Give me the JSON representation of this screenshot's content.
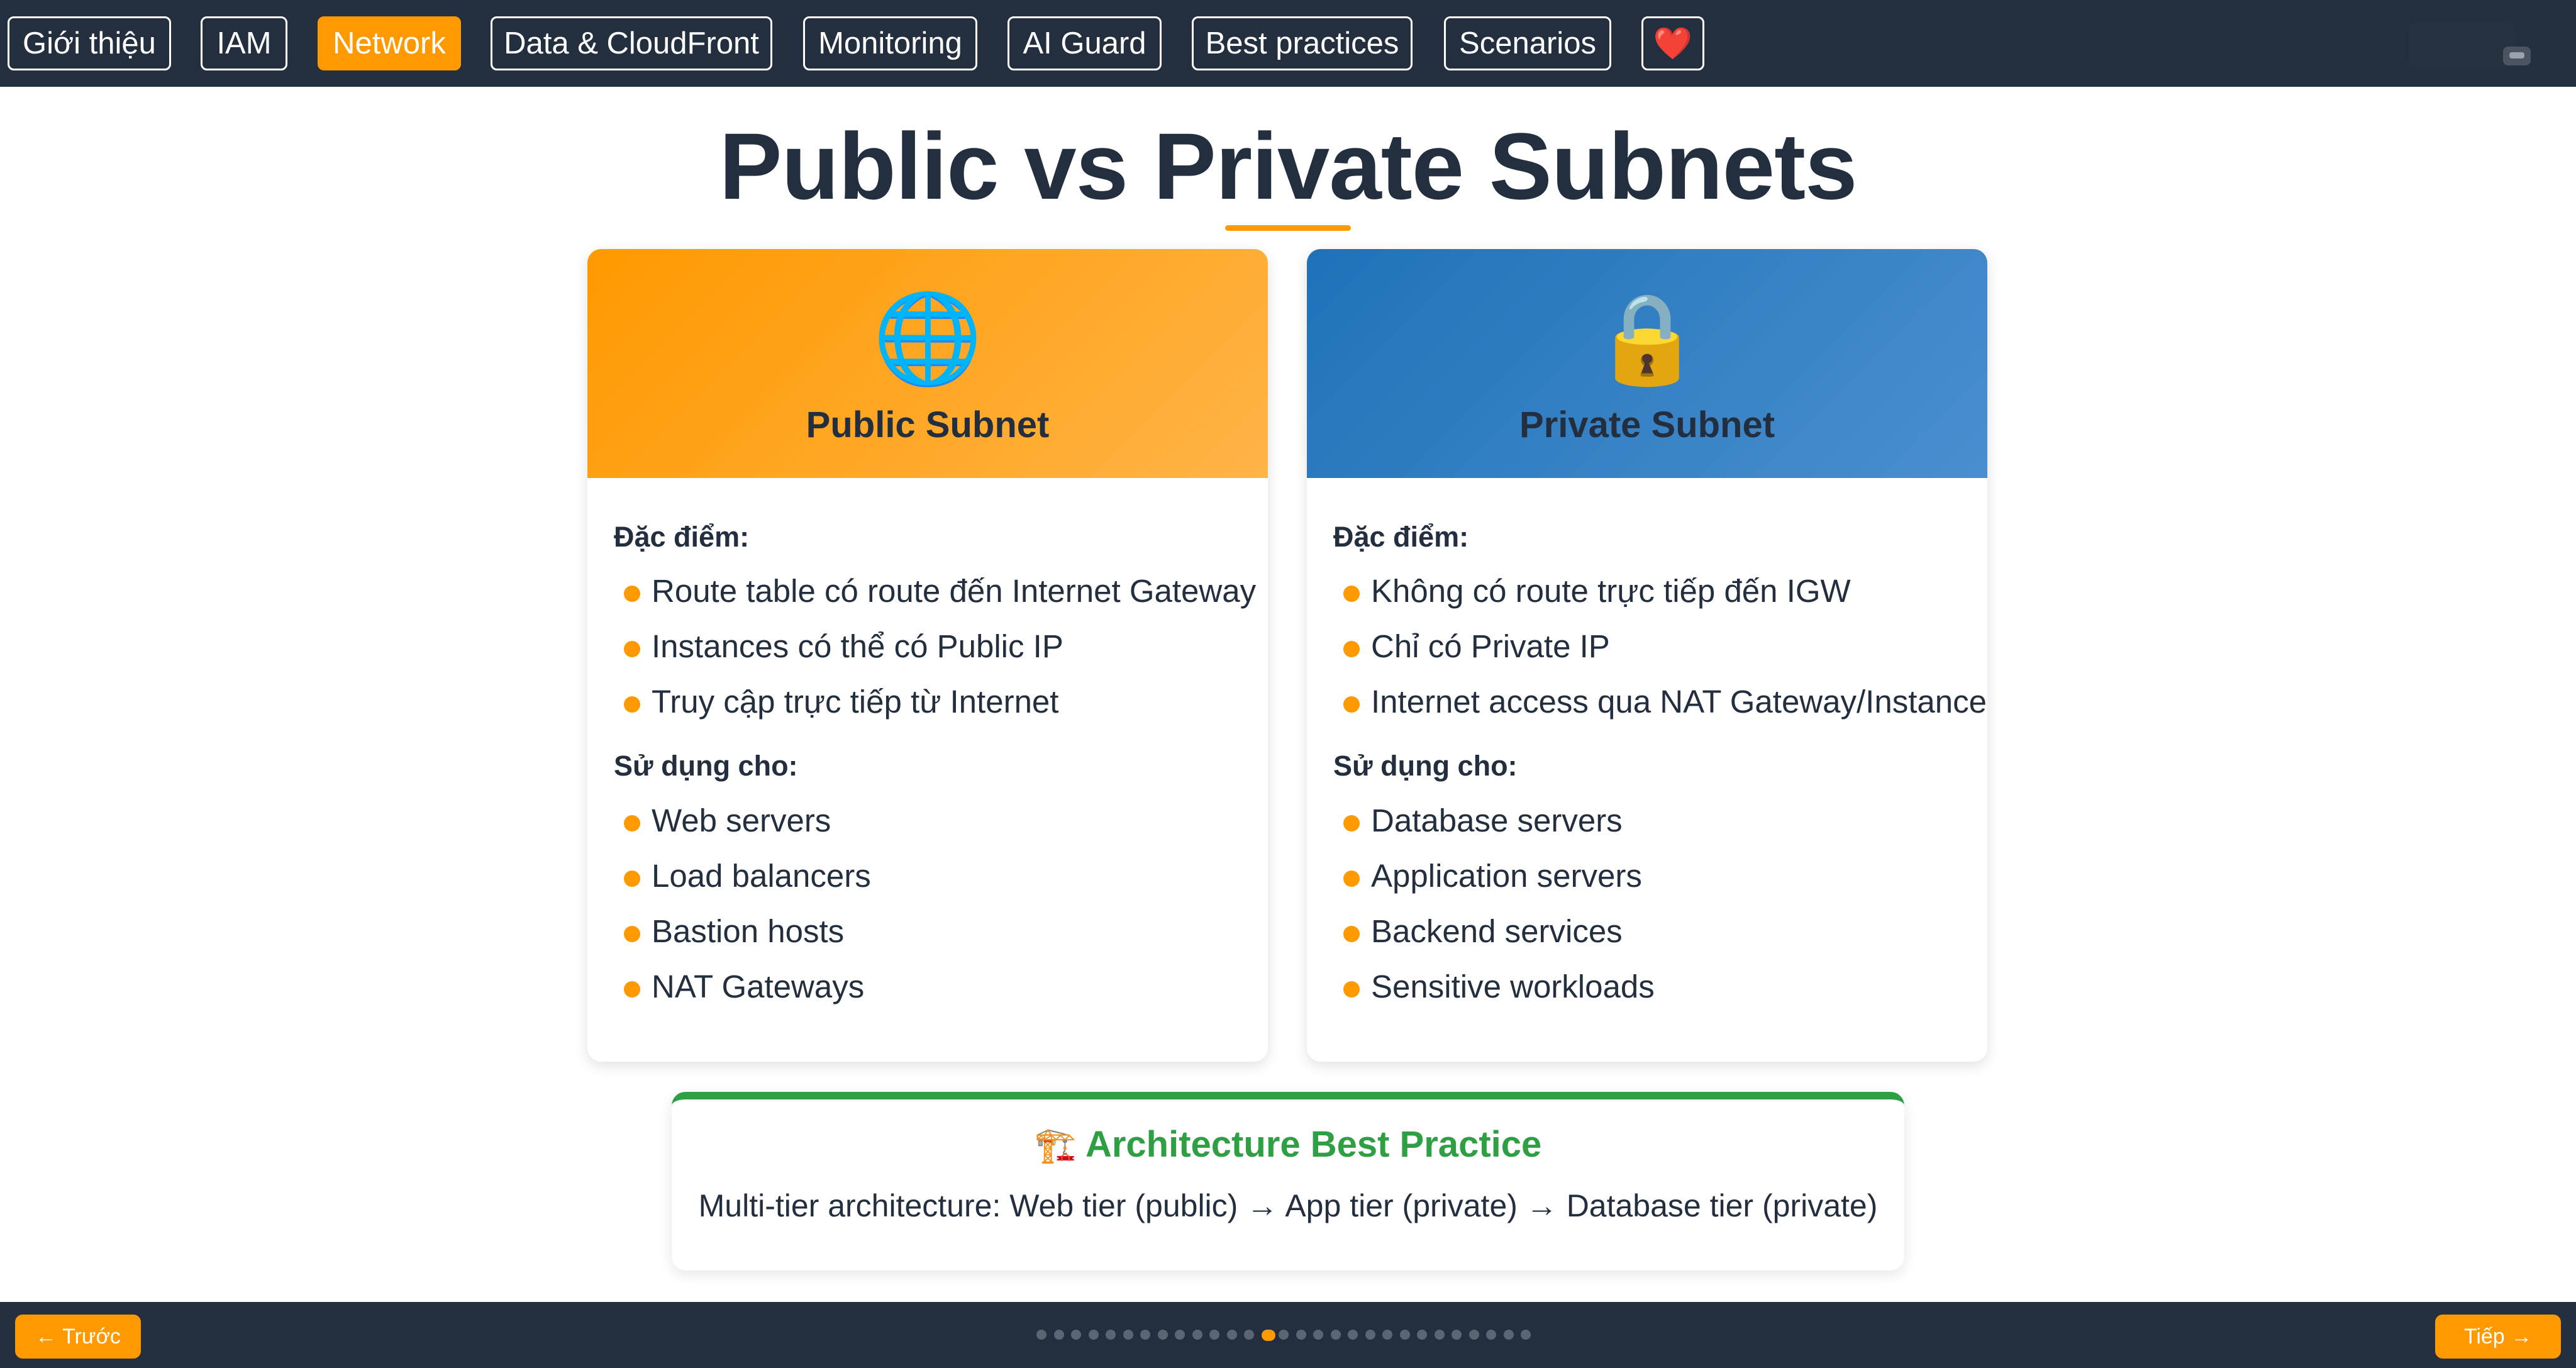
{
  "nav": {
    "tabs": [
      {
        "label": "Giới thiệu",
        "active": false
      },
      {
        "label": "IAM",
        "active": false
      },
      {
        "label": "Network",
        "active": true
      },
      {
        "label": "Data & CloudFront",
        "active": false
      },
      {
        "label": "Monitoring",
        "active": false
      },
      {
        "label": "AI Guard",
        "active": false
      },
      {
        "label": "Best practices",
        "active": false
      },
      {
        "label": "Scenarios",
        "active": false
      }
    ],
    "heart_icon": "heart-icon"
  },
  "title": "Public vs Private Subnets",
  "cards": {
    "public": {
      "icon": "globe-icon",
      "icon_glyph": "🌐",
      "title": "Public Subnet",
      "features_label": "Đặc điểm:",
      "features": [
        "Route table có route đến Internet Gateway",
        "Instances có thể có Public IP",
        "Truy cập trực tiếp từ Internet"
      ],
      "uses_label": "Sử dụng cho:",
      "uses": [
        "Web servers",
        "Load balancers",
        "Bastion hosts",
        "NAT Gateways"
      ]
    },
    "private": {
      "icon": "lock-icon",
      "icon_glyph": "🔒",
      "title": "Private Subnet",
      "features_label": "Đặc điểm:",
      "features": [
        "Không có route trực tiếp đến IGW",
        "Chỉ có Private IP",
        "Internet access qua NAT Gateway/Instance"
      ],
      "uses_label": "Sử dụng cho:",
      "uses": [
        "Database servers",
        "Application servers",
        "Backend services",
        "Sensitive workloads"
      ]
    }
  },
  "best_practice": {
    "icon": "construction-crane-icon",
    "icon_glyph": "🏗️",
    "title": "Architecture Best Practice",
    "text": "Multi-tier architecture: Web tier (public) → App tier (private) → Database tier (private)"
  },
  "footer": {
    "prev_label": "← Trước",
    "next_label": "Tiếp →",
    "slide_count": 29,
    "active_slide": 13
  },
  "colors": {
    "accent": "#ff9900",
    "dark": "#232f3e",
    "private_blue": "#1f72b8",
    "success_green": "#2ea043"
  }
}
